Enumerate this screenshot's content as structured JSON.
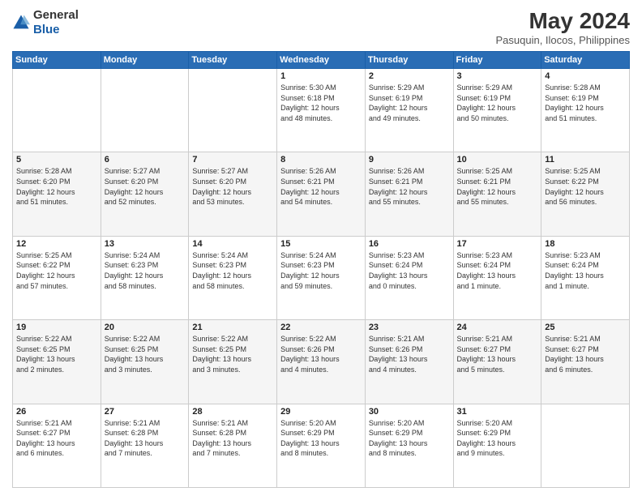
{
  "header": {
    "logo_general": "General",
    "logo_blue": "Blue",
    "month_year": "May 2024",
    "location": "Pasuquin, Ilocos, Philippines"
  },
  "weekdays": [
    "Sunday",
    "Monday",
    "Tuesday",
    "Wednesday",
    "Thursday",
    "Friday",
    "Saturday"
  ],
  "weeks": [
    [
      {
        "day": "",
        "info": ""
      },
      {
        "day": "",
        "info": ""
      },
      {
        "day": "",
        "info": ""
      },
      {
        "day": "1",
        "info": "Sunrise: 5:30 AM\nSunset: 6:18 PM\nDaylight: 12 hours\nand 48 minutes."
      },
      {
        "day": "2",
        "info": "Sunrise: 5:29 AM\nSunset: 6:19 PM\nDaylight: 12 hours\nand 49 minutes."
      },
      {
        "day": "3",
        "info": "Sunrise: 5:29 AM\nSunset: 6:19 PM\nDaylight: 12 hours\nand 50 minutes."
      },
      {
        "day": "4",
        "info": "Sunrise: 5:28 AM\nSunset: 6:19 PM\nDaylight: 12 hours\nand 51 minutes."
      }
    ],
    [
      {
        "day": "5",
        "info": "Sunrise: 5:28 AM\nSunset: 6:20 PM\nDaylight: 12 hours\nand 51 minutes."
      },
      {
        "day": "6",
        "info": "Sunrise: 5:27 AM\nSunset: 6:20 PM\nDaylight: 12 hours\nand 52 minutes."
      },
      {
        "day": "7",
        "info": "Sunrise: 5:27 AM\nSunset: 6:20 PM\nDaylight: 12 hours\nand 53 minutes."
      },
      {
        "day": "8",
        "info": "Sunrise: 5:26 AM\nSunset: 6:21 PM\nDaylight: 12 hours\nand 54 minutes."
      },
      {
        "day": "9",
        "info": "Sunrise: 5:26 AM\nSunset: 6:21 PM\nDaylight: 12 hours\nand 55 minutes."
      },
      {
        "day": "10",
        "info": "Sunrise: 5:25 AM\nSunset: 6:21 PM\nDaylight: 12 hours\nand 55 minutes."
      },
      {
        "day": "11",
        "info": "Sunrise: 5:25 AM\nSunset: 6:22 PM\nDaylight: 12 hours\nand 56 minutes."
      }
    ],
    [
      {
        "day": "12",
        "info": "Sunrise: 5:25 AM\nSunset: 6:22 PM\nDaylight: 12 hours\nand 57 minutes."
      },
      {
        "day": "13",
        "info": "Sunrise: 5:24 AM\nSunset: 6:23 PM\nDaylight: 12 hours\nand 58 minutes."
      },
      {
        "day": "14",
        "info": "Sunrise: 5:24 AM\nSunset: 6:23 PM\nDaylight: 12 hours\nand 58 minutes."
      },
      {
        "day": "15",
        "info": "Sunrise: 5:24 AM\nSunset: 6:23 PM\nDaylight: 12 hours\nand 59 minutes."
      },
      {
        "day": "16",
        "info": "Sunrise: 5:23 AM\nSunset: 6:24 PM\nDaylight: 13 hours\nand 0 minutes."
      },
      {
        "day": "17",
        "info": "Sunrise: 5:23 AM\nSunset: 6:24 PM\nDaylight: 13 hours\nand 1 minute."
      },
      {
        "day": "18",
        "info": "Sunrise: 5:23 AM\nSunset: 6:24 PM\nDaylight: 13 hours\nand 1 minute."
      }
    ],
    [
      {
        "day": "19",
        "info": "Sunrise: 5:22 AM\nSunset: 6:25 PM\nDaylight: 13 hours\nand 2 minutes."
      },
      {
        "day": "20",
        "info": "Sunrise: 5:22 AM\nSunset: 6:25 PM\nDaylight: 13 hours\nand 3 minutes."
      },
      {
        "day": "21",
        "info": "Sunrise: 5:22 AM\nSunset: 6:25 PM\nDaylight: 13 hours\nand 3 minutes."
      },
      {
        "day": "22",
        "info": "Sunrise: 5:22 AM\nSunset: 6:26 PM\nDaylight: 13 hours\nand 4 minutes."
      },
      {
        "day": "23",
        "info": "Sunrise: 5:21 AM\nSunset: 6:26 PM\nDaylight: 13 hours\nand 4 minutes."
      },
      {
        "day": "24",
        "info": "Sunrise: 5:21 AM\nSunset: 6:27 PM\nDaylight: 13 hours\nand 5 minutes."
      },
      {
        "day": "25",
        "info": "Sunrise: 5:21 AM\nSunset: 6:27 PM\nDaylight: 13 hours\nand 6 minutes."
      }
    ],
    [
      {
        "day": "26",
        "info": "Sunrise: 5:21 AM\nSunset: 6:27 PM\nDaylight: 13 hours\nand 6 minutes."
      },
      {
        "day": "27",
        "info": "Sunrise: 5:21 AM\nSunset: 6:28 PM\nDaylight: 13 hours\nand 7 minutes."
      },
      {
        "day": "28",
        "info": "Sunrise: 5:21 AM\nSunset: 6:28 PM\nDaylight: 13 hours\nand 7 minutes."
      },
      {
        "day": "29",
        "info": "Sunrise: 5:20 AM\nSunset: 6:29 PM\nDaylight: 13 hours\nand 8 minutes."
      },
      {
        "day": "30",
        "info": "Sunrise: 5:20 AM\nSunset: 6:29 PM\nDaylight: 13 hours\nand 8 minutes."
      },
      {
        "day": "31",
        "info": "Sunrise: 5:20 AM\nSunset: 6:29 PM\nDaylight: 13 hours\nand 9 minutes."
      },
      {
        "day": "",
        "info": ""
      }
    ]
  ]
}
